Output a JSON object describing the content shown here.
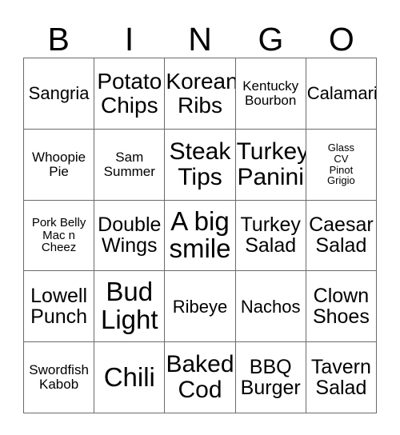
{
  "card": {
    "type": "bingo-card",
    "header": {
      "letters": [
        "B",
        "I",
        "N",
        "G",
        "O"
      ]
    },
    "grid": {
      "rows": 5,
      "columns": 5,
      "border_color": "#6b6b6b",
      "cell_background": "#ffffff",
      "text_color": "#000000"
    },
    "cells": [
      {
        "text": "Sangria",
        "size": "sm",
        "align": "center"
      },
      {
        "text": "Potato\nChips",
        "size": "lg",
        "align": "center"
      },
      {
        "text": "Korean\nRibs",
        "size": "lg",
        "align": "center"
      },
      {
        "text": "Kentucky\nBourbon",
        "size": "xs",
        "align": "center"
      },
      {
        "text": "Calamari",
        "size": "sm",
        "align": "center"
      },
      {
        "text": "Whoopie\nPie",
        "size": "xs",
        "align": "center"
      },
      {
        "text": "Sam\nSummer",
        "size": "xs",
        "align": "center"
      },
      {
        "text": "Steak\nTips",
        "size": "xl",
        "align": "center"
      },
      {
        "text": "Turkey\nPanini",
        "size": "xl",
        "align": "center"
      },
      {
        "text": "Glass\nCV\nPinot\nGrigio",
        "size": "tiny",
        "align": "center"
      },
      {
        "text": "Pork Belly\nMac n\nCheez",
        "size": "xxs",
        "align": "center"
      },
      {
        "text": "Double\nWings",
        "size": "md",
        "align": "center"
      },
      {
        "text": "A big\nsmile",
        "size": "xxl",
        "align": "center"
      },
      {
        "text": "Turkey\nSalad",
        "size": "md",
        "align": "center"
      },
      {
        "text": "Caesar\nSalad",
        "size": "md",
        "align": "center"
      },
      {
        "text": "Lowell\nPunch",
        "size": "md",
        "align": "center"
      },
      {
        "text": "Bud\nLight",
        "size": "xxl",
        "align": "center"
      },
      {
        "text": "Ribeye",
        "size": "sm",
        "align": "center"
      },
      {
        "text": "Nachos",
        "size": "sm",
        "align": "center"
      },
      {
        "text": "Clown\nShoes",
        "size": "md",
        "align": "center"
      },
      {
        "text": "Swordfish\nKabob",
        "size": "xs",
        "align": "center"
      },
      {
        "text": "Chili",
        "size": "xxl",
        "align": "center"
      },
      {
        "text": "Baked\nCod",
        "size": "xl",
        "align": "center"
      },
      {
        "text": "BBQ\nBurger",
        "size": "md",
        "align": "center"
      },
      {
        "text": "Tavern\nSalad",
        "size": "md",
        "align": "center"
      }
    ]
  }
}
